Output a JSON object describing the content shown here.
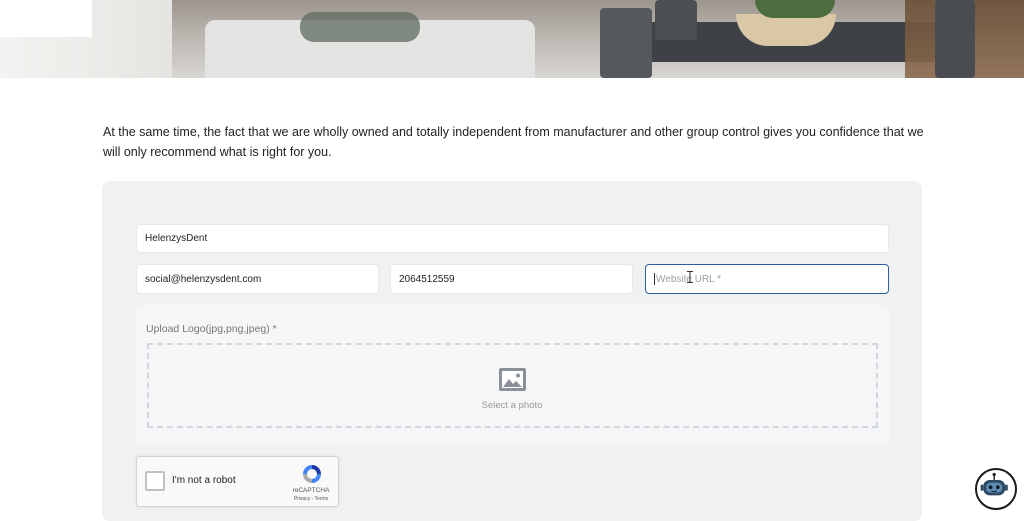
{
  "intro": {
    "text": "At the same time, the fact that we are wholly owned and totally independent from manufacturer and other group control gives you confidence that we will only recommend what is right for you."
  },
  "form": {
    "name_value": "HelenzysDent",
    "email_value": "social@helenzysdent.com",
    "phone_value": "2064512559",
    "url_placeholder": "Website URL *",
    "upload_label": "Upload Logo(jpg,png,jpeg) *",
    "select_photo": "Select a photo"
  },
  "recaptcha": {
    "label": "I'm not a robot",
    "brand": "reCAPTCHA",
    "terms": "Privacy - Terms"
  },
  "icons": {
    "photo": "image-icon",
    "recaptcha": "recaptcha-logo-icon",
    "chatbot": "robot-icon",
    "cursor": "text-cursor-icon"
  },
  "colors": {
    "panel_bg": "#eff1f2",
    "focus_border": "#2f5fa0"
  }
}
